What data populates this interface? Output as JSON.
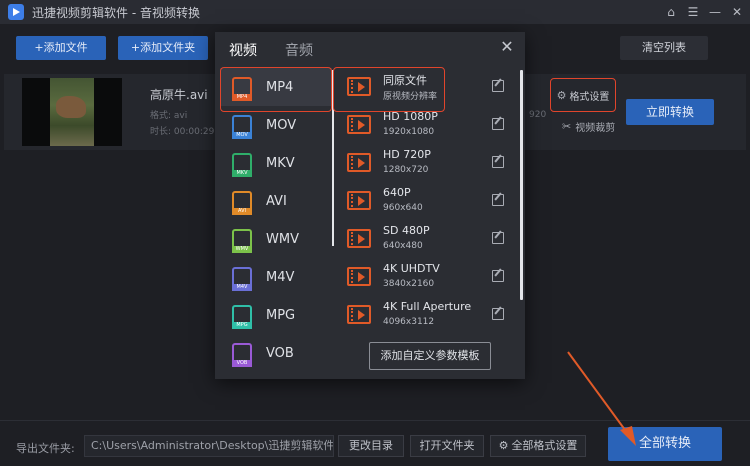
{
  "app": {
    "title": "迅捷视频剪辑软件 - 音视频转换"
  },
  "window": {
    "home_icon": "home-icon",
    "menu_icon": "menu-icon",
    "min_icon": "minimize-icon",
    "close_icon": "close-icon"
  },
  "toolbar": {
    "add_file": "+添加文件",
    "add_folder": "+添加文件夹",
    "clear_list": "清空列表"
  },
  "file": {
    "name": "高原牛.avi",
    "format_line": "格式: avi",
    "duration_line": "时长: 00:00:29",
    "resolution": "920",
    "format_settings": "格式设置",
    "video_crop": "视频裁剪",
    "convert_now": "立即转换"
  },
  "panel": {
    "tab_video": "视频",
    "tab_audio": "音频",
    "formats": [
      {
        "name": "MP4",
        "tag": "MP4",
        "color": "#e05a28"
      },
      {
        "name": "MOV",
        "tag": "MOV",
        "color": "#3b82d6"
      },
      {
        "name": "MKV",
        "tag": "MKV",
        "color": "#2fae6a"
      },
      {
        "name": "AVI",
        "tag": "AVI",
        "color": "#e08a28"
      },
      {
        "name": "WMV",
        "tag": "WMV",
        "color": "#7cc24a"
      },
      {
        "name": "M4V",
        "tag": "M4V",
        "color": "#6a6fd6"
      },
      {
        "name": "MPG",
        "tag": "MPG",
        "color": "#2fbfa8"
      },
      {
        "name": "VOB",
        "tag": "VOB",
        "color": "#9a5ad6"
      }
    ],
    "options": [
      {
        "title": "同原文件",
        "sub": "原视频分辨率"
      },
      {
        "title": "HD 1080P",
        "sub": "1920x1080"
      },
      {
        "title": "HD 720P",
        "sub": "1280x720"
      },
      {
        "title": "640P",
        "sub": "960x640"
      },
      {
        "title": "SD 480P",
        "sub": "640x480"
      },
      {
        "title": "4K UHDTV",
        "sub": "3840x2160"
      },
      {
        "title": "4K Full Aperture",
        "sub": "4096x3112"
      }
    ],
    "add_custom": "添加自定义参数模板"
  },
  "bottom": {
    "output_label": "导出文件夹:",
    "output_path": "C:\\Users\\Administrator\\Desktop\\迅捷剪辑软件",
    "change_dir": "更改目录",
    "open_folder": "打开文件夹",
    "all_format_settings": "全部格式设置",
    "convert_all": "全部转换"
  },
  "colors": {
    "accent": "#2a63b8",
    "highlight": "#e0452c",
    "video_icon": "#e05a28"
  }
}
